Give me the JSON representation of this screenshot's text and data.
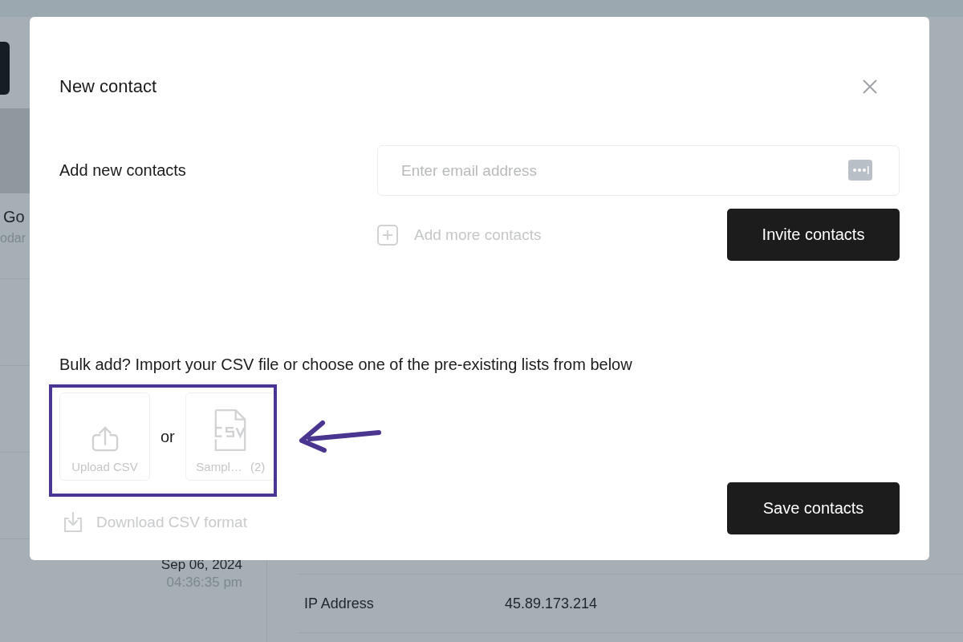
{
  "background": {
    "list_item": {
      "title": "Go",
      "subtitle": "odar"
    },
    "date": "Sep 06, 2024",
    "time": "04:36:35 pm",
    "details": [
      {
        "label": "IP Address",
        "value": "45.89.173.214"
      }
    ]
  },
  "dialog": {
    "title": "New contact",
    "add_label": "Add new contacts",
    "email_field": {
      "placeholder": "Enter email address"
    },
    "add_more": "Add more contacts",
    "invite_button": "Invite contacts",
    "bulk_text": "Bulk add? Import your CSV file or choose one of the pre-existing lists from below",
    "upload_option": "Upload CSV",
    "separator": "or",
    "sample_option": {
      "label": "Sampl…",
      "count": "(2)"
    },
    "download_link": "Download CSV format",
    "save_button": "Save contacts"
  }
}
